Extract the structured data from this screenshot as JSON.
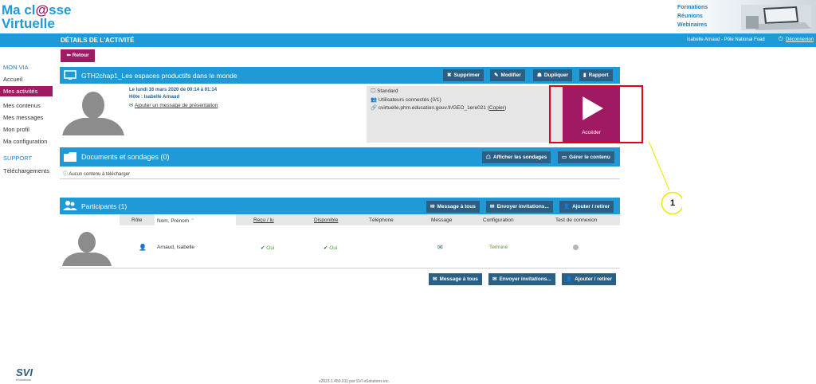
{
  "header": {
    "logo_line1_a": "Ma cl",
    "logo_line1_b": "@",
    "logo_line1_c": "sse",
    "logo_line2": "Virtuelle",
    "links": [
      "Formations",
      "Réunions",
      "Webinaires"
    ]
  },
  "titlebar": {
    "title": "DÉTAILS DE L'ACTIVITÉ",
    "user": "Isabelle Arnaud - Pôle National Foad",
    "logout": "Déconnexion"
  },
  "sidebar": {
    "section1": "MON VIA",
    "items": [
      "Accueil",
      "Mes activités",
      "Mes contenus",
      "Mes messages",
      "Mon profil",
      "Ma configuration"
    ],
    "section2": "SUPPORT",
    "items2": [
      "Téléchargements"
    ]
  },
  "back_label": "Retour",
  "activity": {
    "title": "GTH2chap1_Les espaces productifs dans le monde",
    "buttons": [
      "Supprimer",
      "Modifier",
      "Dupliquer",
      "Rapport"
    ],
    "date": "Le lundi 16 mars 2020 de 00:14 à 01:14",
    "host": "Hôte : Isabelle Arnaud",
    "add_message": "Ajouter un message de présentation",
    "type": "Standard",
    "connected": "Utilisateurs connectés (0/1)",
    "link": "cvirtuelle.phm.education.gouv.fr/GEO_1ere021",
    "copy": "Copier",
    "access": "Accéder"
  },
  "documents": {
    "title": "Documents et sondages (0)",
    "buttons": [
      "Afficher les sondages",
      "Gérer le contenu"
    ],
    "empty": "Aucun contenu à télécharger"
  },
  "participants": {
    "title": "Participants (1)",
    "buttons": [
      "Message à tous",
      "Envoyer invitations...",
      "Ajouter / retirer"
    ],
    "columns": [
      "Rôle",
      "Nom, Prénom",
      "Reçu / lu",
      "Disponible",
      "Téléphone",
      "Message",
      "Configuration",
      "Test de connexion"
    ],
    "rows": [
      {
        "name": "Arnaud, Isabelle",
        "recu": "Oui",
        "disponible": "Oui",
        "configuration": "Terminé"
      }
    ]
  },
  "annotation": {
    "number": "1"
  },
  "footer": {
    "brand": "SVI",
    "sub": "eSolutions",
    "copyright": "v2023.1.450.011 par SVI eSolutions inc."
  },
  "colors": {
    "blue": "#1f9ad6",
    "dark_button": "#2a5f86",
    "accent": "#a01a63",
    "highlight": "#e0001b",
    "annotation": "#f0e800"
  }
}
